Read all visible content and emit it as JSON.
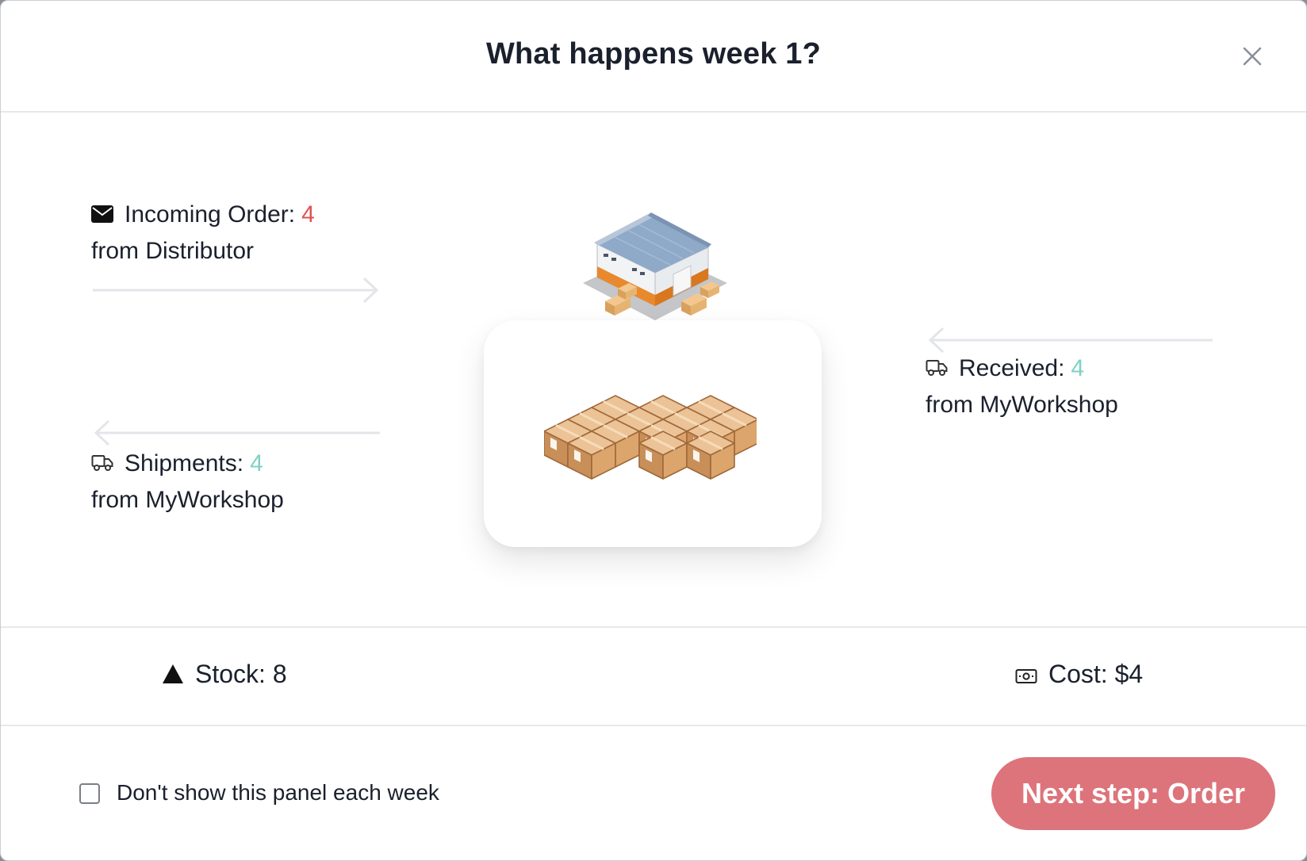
{
  "modal": {
    "title": "What happens week 1?",
    "close_icon": "close-icon"
  },
  "incoming_order": {
    "icon": "envelope-icon",
    "label": "Incoming Order:",
    "value": "4",
    "source": "from Distributor"
  },
  "shipments": {
    "icon": "truck-icon",
    "label": "Shipments:",
    "value": "4",
    "source": "from MyWorkshop"
  },
  "received": {
    "icon": "truck-icon",
    "label": "Received:",
    "value": "4",
    "source": "from MyWorkshop"
  },
  "stats": {
    "stock_icon": "triangle-up-icon",
    "stock_label": "Stock: 8",
    "cost_icon": "money-icon",
    "cost_label": "Cost: $4"
  },
  "footer": {
    "checkbox_label": "Don't show this panel each week",
    "checkbox_checked": false,
    "next_button": "Next step: Order"
  },
  "colors": {
    "red_value": "#e0524f",
    "teal_value": "#7fd1c4",
    "button": "#dd747b"
  }
}
